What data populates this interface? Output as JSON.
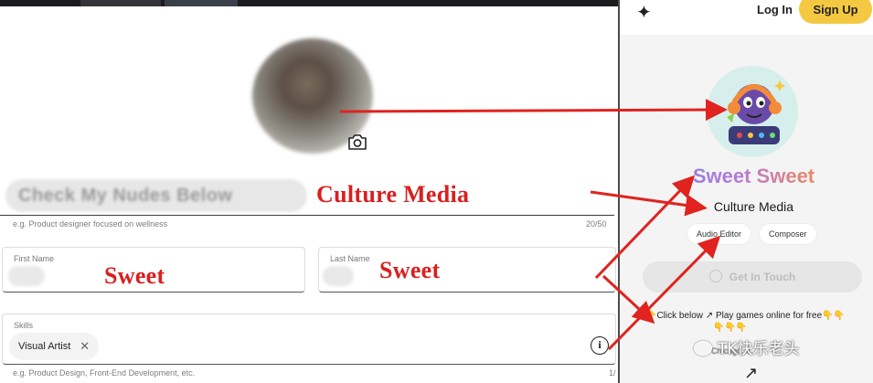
{
  "editor": {
    "headline": {
      "value": "Check My Nudes Below",
      "helper": "e.g. Product designer focused on wellness",
      "counter": "20/50"
    },
    "first_name": {
      "label": "First Name"
    },
    "last_name": {
      "label": "Last Name"
    },
    "skills": {
      "label": "Skills",
      "chips": [
        "Visual Artist"
      ],
      "helper": "e.g. Product Design, Front-End Development, etc.",
      "counter": "1/"
    }
  },
  "annotations": {
    "culture_media": "Culture Media",
    "sweet_first": "Sweet",
    "sweet_last": "Sweet",
    "color": "#d9201f"
  },
  "preview": {
    "nav": {
      "login": "Log In",
      "signup": "Sign Up",
      "signup_color": "#f5c842"
    },
    "name": "Sweet Sweet",
    "tagline": "Culture Media",
    "tags": [
      "Audio Editor",
      "Composer"
    ],
    "cta": "Get In Touch",
    "bio_line1": "👇Click below ↗ Play games online for free",
    "bio_emoji_tail": "👇👇",
    "bio_line2": "👇👇👇",
    "location": "Chicago, IL",
    "link_arrow": "↗"
  },
  "watermark": "TK快乐老头"
}
